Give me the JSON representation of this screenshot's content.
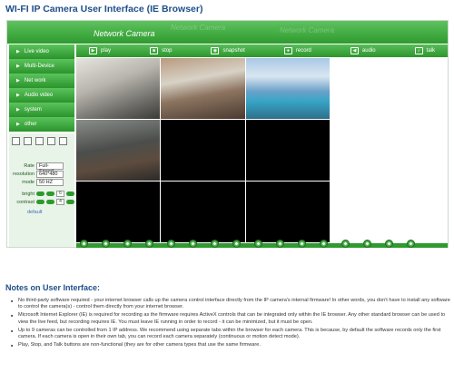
{
  "page_title": "WI-FI IP Camera User Interface (IE Browser)",
  "app": {
    "brand": "Network Camera",
    "colors": {
      "accent": "#2e9a2e",
      "panel": "#e9f4e9",
      "title": "#1f4f8a"
    }
  },
  "toolbar": [
    {
      "label": "play",
      "icon": "play-icon"
    },
    {
      "label": "stop",
      "icon": "stop-icon"
    },
    {
      "label": "snapshot",
      "icon": "camera-icon"
    },
    {
      "label": "record",
      "icon": "record-icon"
    },
    {
      "label": "audio",
      "icon": "speaker-icon"
    },
    {
      "label": "talk",
      "icon": "microphone-icon"
    }
  ],
  "sidebar": {
    "items": [
      {
        "label": "Live video"
      },
      {
        "label": "Multi-Device"
      },
      {
        "label": "Net work"
      },
      {
        "label": "Audio video"
      },
      {
        "label": "system"
      },
      {
        "label": "other"
      }
    ]
  },
  "controls": {
    "rate": {
      "label": "Rate",
      "value": "Full-Speed"
    },
    "resolution": {
      "label": "resolution",
      "value": "640*480"
    },
    "mode": {
      "label": "mode",
      "value": "50 HZ"
    },
    "bright": {
      "label": "bright",
      "value": "6"
    },
    "contrast": {
      "label": "contrast",
      "value": "4"
    },
    "refresh": "default"
  },
  "notes": {
    "title": "Notes on User Interface:",
    "items": [
      "No third-party software required - your internet browser calls up the camera control interface directly from the IP camera's internal firmware! In other words, you don't have to install any software to control the camera(s) - control them directly from your internet browser.",
      "Microsoft Internet Explorer (IE) is required for recording as the firmware requires ActiveX controls that can be integrated only within the IE browser. Any other standard browser can be used to view the live feed, but recording requires IE. You must leave IE running in order to record - it can be minimized, but it must be open.",
      "Up to 9 cameras can be controlled from 1 IP address. We recommend using separate tabs within the browser for each camera. This is because, by default the software records only the first camera. If each camera is open in their own tab, you can record each camera separately (continuous or motion detect mode).",
      "Play, Stop, and Talk buttons are non-functional (they are for other camera types that use the same firmware."
    ]
  }
}
